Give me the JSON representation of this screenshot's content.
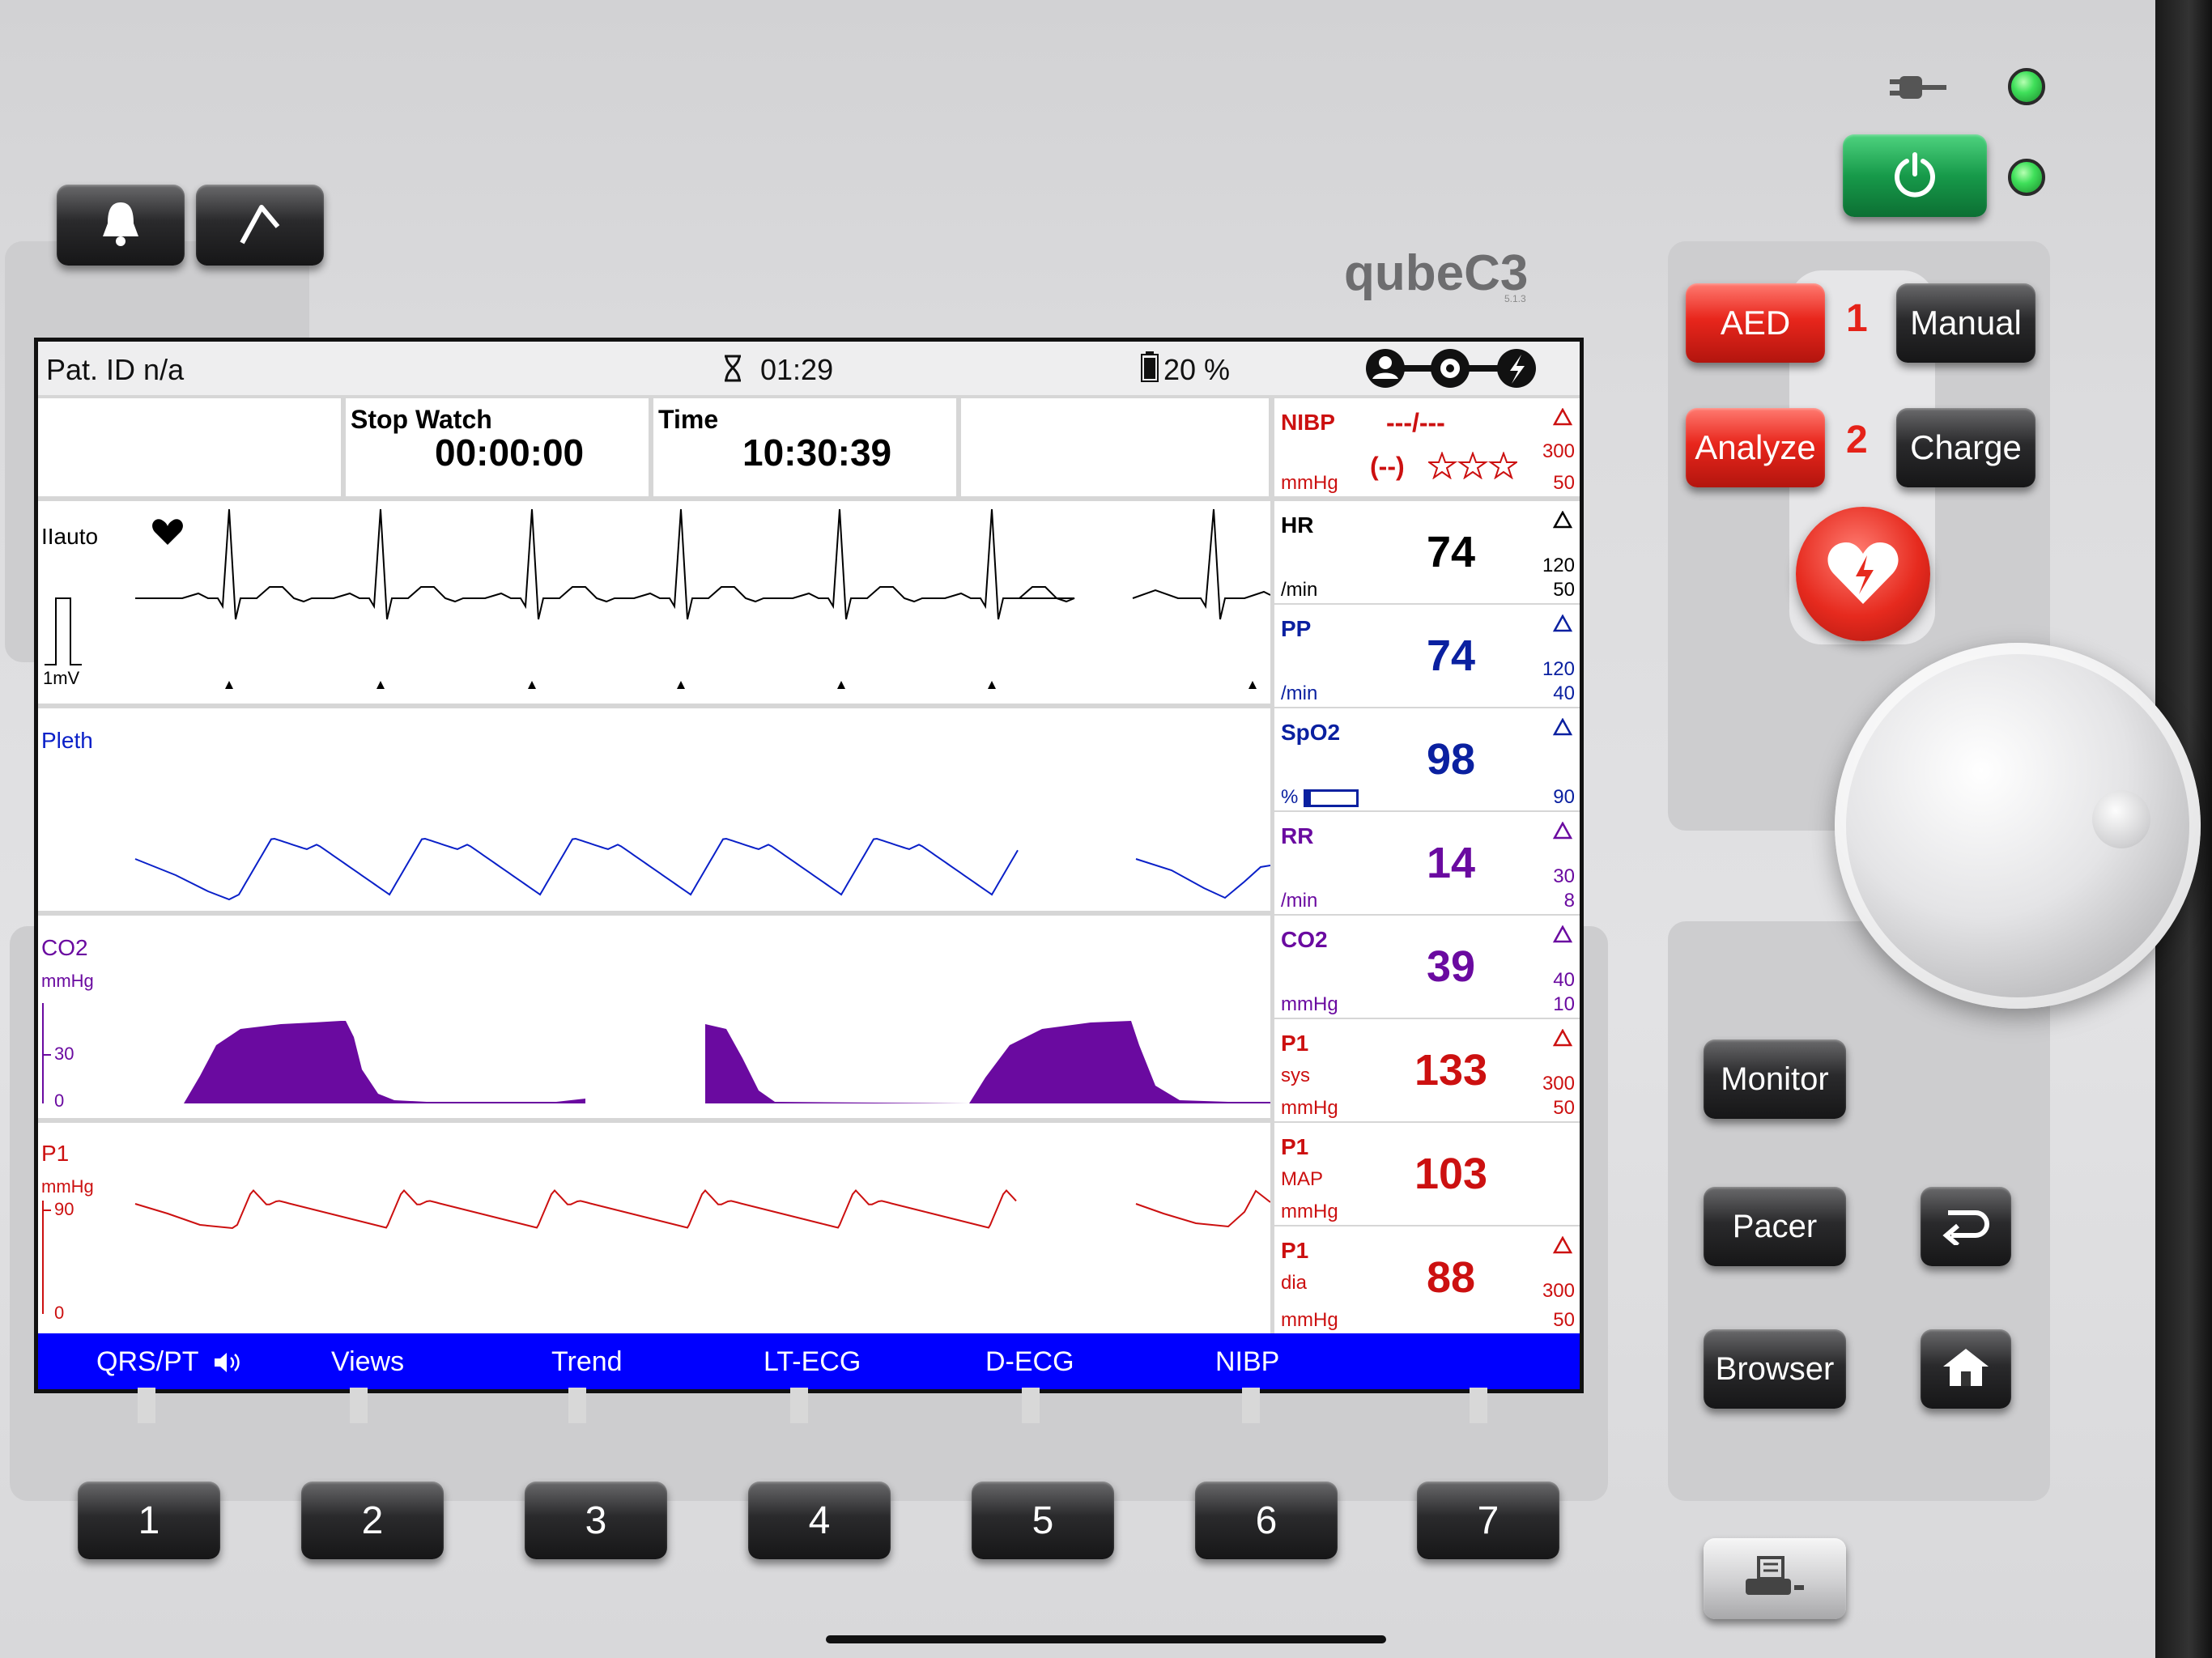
{
  "device": {
    "brand": "qubeC3",
    "version": "5.1.3"
  },
  "top_buttons": {
    "alarm_icon": "bell-icon",
    "event_icon": "flag-marker-icon"
  },
  "right_panel": {
    "aed_label": "AED",
    "manual_label": "Manual",
    "analyze_label": "Analyze",
    "charge_label": "Charge",
    "step1": "1",
    "step2": "2",
    "monitor_label": "Monitor",
    "pacer_label": "Pacer",
    "browser_label": "Browser"
  },
  "status_bar": {
    "patient_id": "Pat. ID n/a",
    "timer": "01:29",
    "battery": "20 %"
  },
  "info_boxes": {
    "stopwatch_label": "Stop Watch",
    "stopwatch_value": "00:00:00",
    "time_label": "Time",
    "time_value": "10:30:39"
  },
  "waveforms": {
    "ecg_lead": "IIauto",
    "ecg_scale": "1mV",
    "pleth_label": "Pleth",
    "co2_label": "CO2",
    "co2_unit": "mmHg",
    "co2_tick_30": "30",
    "co2_tick_0": "0",
    "p1_label": "P1",
    "p1_unit": "mmHg",
    "p1_tick_90": "90",
    "p1_tick_0": "0"
  },
  "parameters": {
    "nibp": {
      "name": "NIBP",
      "value": "---/---",
      "mean": "(--)",
      "unit": "mmHg",
      "high": "300",
      "low": "50"
    },
    "hr": {
      "name": "HR",
      "value": "74",
      "unit": "/min",
      "high": "120",
      "low": "50"
    },
    "pp": {
      "name": "PP",
      "value": "74",
      "unit": "/min",
      "high": "120",
      "low": "40"
    },
    "spo2": {
      "name": "SpO2",
      "value": "98",
      "unit": "%",
      "low": "90"
    },
    "rr": {
      "name": "RR",
      "value": "14",
      "unit": "/min",
      "high": "30",
      "low": "8"
    },
    "co2": {
      "name": "CO2",
      "value": "39",
      "unit": "mmHg",
      "high": "40",
      "low": "10"
    },
    "p1_sys": {
      "name": "P1",
      "sub": "sys",
      "value": "133",
      "unit": "mmHg",
      "high": "300",
      "low": "50"
    },
    "p1_map": {
      "name": "P1",
      "sub": "MAP",
      "value": "103",
      "unit": "mmHg"
    },
    "p1_dia": {
      "name": "P1",
      "sub": "dia",
      "value": "88",
      "unit": "mmHg",
      "high": "300",
      "low": "50"
    }
  },
  "softkeys": [
    "QRS/PT",
    "Views",
    "Trend",
    "LT-ECG",
    "D-ECG",
    "NIBP"
  ],
  "number_buttons": [
    "1",
    "2",
    "3",
    "4",
    "5",
    "6",
    "7"
  ],
  "colors": {
    "ecg": "#000000",
    "pleth": "#0a20c8",
    "co2": "#6a0aa0",
    "pressure": "#cc1010",
    "softbar": "#0000ff"
  }
}
